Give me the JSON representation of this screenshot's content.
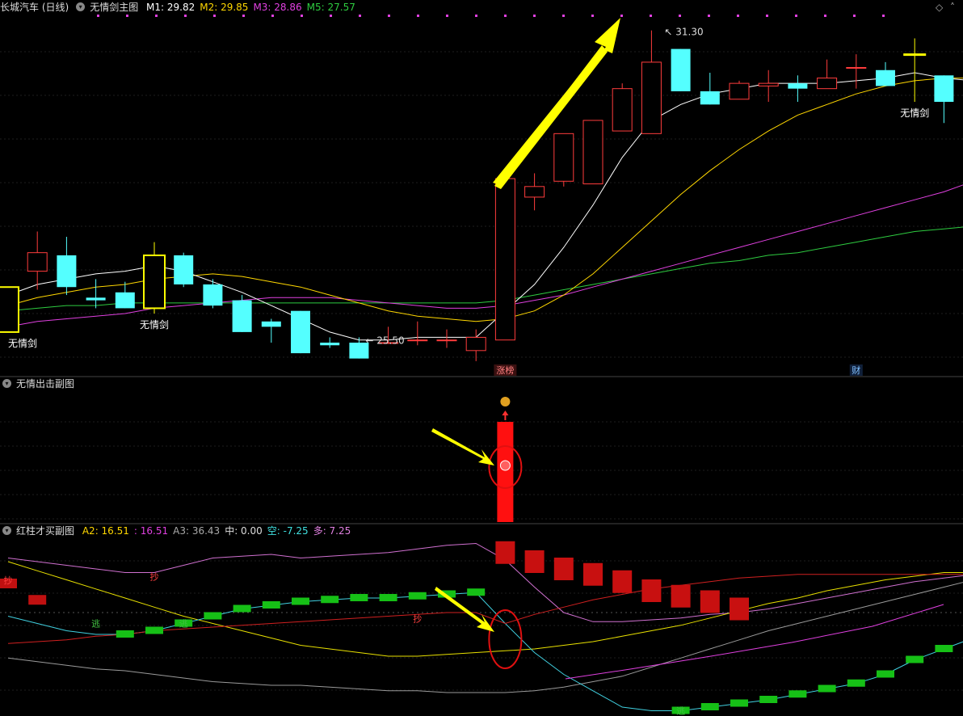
{
  "main_panel": {
    "stock_name": "长城汽车 (日线)",
    "indicator_name": "无情剑主图",
    "legend": [
      {
        "label": "M1:",
        "value": "29.82",
        "color": "#ffffff"
      },
      {
        "label": "M2:",
        "value": "29.85",
        "color": "#ffd700"
      },
      {
        "label": "M3:",
        "value": "28.86",
        "color": "#e040e0"
      },
      {
        "label": "M5:",
        "value": "27.57",
        "color": "#2ecc40"
      }
    ],
    "signal_label": "无情剑",
    "high_label": "31.30",
    "low_label": "25.50",
    "event_zhangbang": "涨榜",
    "event_cai": "财"
  },
  "sub_panel_1": {
    "title": "无情出击副图"
  },
  "sub_panel_2": {
    "title": "红柱才买副图",
    "legend": [
      {
        "label": "A2:",
        "value": "16.51",
        "color": "#ffd700"
      },
      {
        "label": ":",
        "value": "16.51",
        "color": "#e040e0"
      },
      {
        "label": "A3:",
        "value": "36.43",
        "color": "#aaaaaa"
      },
      {
        "label": "中:",
        "value": "0.00",
        "color": "#dddddd"
      },
      {
        "label": "空:",
        "value": "-7.25",
        "color": "#40e0e0"
      },
      {
        "label": "多:",
        "value": "7.25",
        "color": "#e080e0"
      }
    ],
    "marker_chao": "抄",
    "marker_tao": "逃"
  },
  "colors": {
    "up": "#ff3c3c",
    "down": "#54ffff",
    "m1": "#ffffff",
    "m2": "#ffd700",
    "m3": "#e040e0",
    "m5": "#2ecc40",
    "highlight": "#ffff00",
    "arrow": "#ffff00",
    "circle": "#e01010"
  },
  "chart_data": [
    {
      "type": "candlestick",
      "series_names": [
        "M1",
        "M2",
        "M3",
        "M5"
      ],
      "ohlc": [
        [
          26.45,
          26.45,
          25.6,
          25.6
        ],
        [
          26.75,
          27.5,
          26.4,
          27.1
        ],
        [
          27.05,
          27.4,
          26.3,
          26.45
        ],
        [
          26.25,
          26.6,
          26.05,
          26.2
        ],
        [
          26.35,
          26.55,
          26.05,
          26.05
        ],
        [
          26.05,
          27.3,
          25.95,
          27.05
        ],
        [
          27.05,
          27.1,
          26.45,
          26.5
        ],
        [
          26.5,
          26.6,
          26.05,
          26.1
        ],
        [
          26.2,
          26.3,
          25.6,
          25.6
        ],
        [
          25.8,
          25.85,
          25.4,
          25.7
        ],
        [
          26.0,
          26.0,
          25.2,
          25.2
        ],
        [
          25.4,
          25.5,
          25.3,
          25.35
        ],
        [
          25.4,
          25.5,
          25.1,
          25.1
        ],
        [
          25.4,
          25.7,
          25.4,
          25.4
        ],
        [
          25.45,
          25.8,
          25.35,
          25.45
        ],
        [
          25.45,
          25.65,
          25.3,
          25.45
        ],
        [
          25.25,
          25.65,
          25.05,
          25.5
        ],
        [
          25.45,
          28.5,
          25.45,
          28.5
        ],
        [
          28.15,
          28.6,
          27.9,
          28.35
        ],
        [
          28.45,
          29.1,
          28.35,
          29.35
        ],
        [
          28.4,
          29.6,
          28.4,
          29.6
        ],
        [
          29.4,
          30.3,
          29.4,
          30.2
        ],
        [
          29.35,
          31.3,
          29.35,
          30.7
        ],
        [
          30.95,
          30.95,
          30.15,
          30.15
        ],
        [
          30.15,
          30.5,
          29.9,
          29.9
        ],
        [
          30.0,
          30.35,
          30.0,
          30.3
        ],
        [
          30.25,
          30.55,
          29.95,
          30.3
        ],
        [
          30.3,
          30.45,
          29.95,
          30.2
        ],
        [
          30.2,
          30.75,
          30.2,
          30.4
        ],
        [
          30.6,
          30.85,
          30.2,
          30.6
        ],
        [
          30.55,
          30.7,
          30.25,
          30.25
        ],
        [
          30.85,
          31.15,
          29.95,
          30.85
        ],
        [
          30.45,
          30.45,
          29.55,
          29.95
        ],
        [
          30.0,
          30.5,
          29.7,
          30.25
        ],
        [
          30.5,
          30.5,
          30.2,
          30.35
        ]
      ],
      "M1": [
        26.3,
        26.5,
        26.6,
        26.7,
        26.75,
        26.85,
        26.75,
        26.55,
        26.35,
        26.1,
        25.85,
        25.6,
        25.45,
        25.45,
        25.5,
        25.5,
        25.5,
        26.0,
        26.5,
        27.2,
        28.0,
        28.9,
        29.6,
        29.9,
        30.1,
        30.2,
        30.3,
        30.3,
        30.3,
        30.35,
        30.4,
        30.5,
        30.4,
        30.35,
        30.3
      ],
      "M2": [
        26.1,
        26.25,
        26.35,
        26.45,
        26.5,
        26.6,
        26.65,
        26.7,
        26.65,
        26.55,
        26.45,
        26.3,
        26.15,
        26.0,
        25.9,
        25.85,
        25.8,
        25.85,
        26.0,
        26.3,
        26.7,
        27.2,
        27.7,
        28.2,
        28.65,
        29.05,
        29.4,
        29.7,
        29.9,
        30.1,
        30.25,
        30.35,
        30.4,
        30.4,
        30.4
      ],
      "M3": [
        25.7,
        25.8,
        25.85,
        25.9,
        25.95,
        26.05,
        26.1,
        26.15,
        26.2,
        26.25,
        26.25,
        26.25,
        26.2,
        26.15,
        26.1,
        26.05,
        26.05,
        26.1,
        26.2,
        26.3,
        26.45,
        26.6,
        26.75,
        26.9,
        27.05,
        27.2,
        27.35,
        27.5,
        27.65,
        27.8,
        27.95,
        28.1,
        28.25,
        28.45,
        28.65
      ],
      "M5": [
        26.0,
        26.05,
        26.1,
        26.1,
        26.15,
        26.15,
        26.15,
        26.15,
        26.15,
        26.15,
        26.15,
        26.15,
        26.15,
        26.15,
        26.15,
        26.15,
        26.15,
        26.2,
        26.3,
        26.4,
        26.5,
        26.6,
        26.7,
        26.8,
        26.9,
        26.95,
        27.05,
        27.1,
        27.2,
        27.3,
        27.4,
        27.5,
        27.55,
        27.6,
        27.6
      ],
      "signal_bars": [
        0,
        5,
        31
      ],
      "high": 31.3,
      "low": 25.5
    },
    {
      "type": "bar",
      "title": "无情出击副图",
      "signal_bar_index": 17
    },
    {
      "type": "line",
      "title": "红柱才买副图",
      "series_names": [
        "A2",
        "A3",
        "空",
        "多",
        "multi"
      ],
      "A2": [
        28,
        23,
        18,
        13,
        8,
        3,
        -2,
        -6,
        -10,
        -14,
        -18,
        -20,
        -22,
        -24,
        -24,
        -23,
        -22,
        -21,
        -20,
        -18,
        -16,
        -13,
        -10,
        -7,
        -3,
        1,
        5,
        8,
        12,
        15,
        18,
        20,
        22,
        22,
        21
      ],
      "pink": [
        30,
        28,
        26,
        24,
        22,
        22,
        26,
        30,
        31,
        32,
        30,
        31,
        32,
        33,
        35,
        37,
        38,
        29,
        14,
        0,
        -5,
        -5,
        -4,
        -3,
        -1,
        0,
        2,
        5,
        8,
        11,
        14,
        17,
        19,
        21,
        22
      ],
      "A3": [
        -25,
        -27,
        -29,
        -31,
        -32,
        -34,
        -36,
        -38,
        -39,
        -40,
        -40,
        -41,
        -42,
        -43,
        -43,
        -44,
        -44,
        -44,
        -43,
        -41,
        -38,
        -35,
        -30,
        -25,
        -20,
        -15,
        -10,
        -6,
        -2,
        2,
        6,
        10,
        14,
        18,
        22
      ],
      "cyan": [
        -2,
        -6,
        -10,
        -12,
        -12,
        -10,
        -6,
        -2,
        2,
        4,
        6,
        7,
        8,
        8,
        9,
        10,
        11,
        -6,
        -22,
        -34,
        -43,
        -52,
        -54,
        -54,
        -52,
        -50,
        -48,
        -45,
        -42,
        -39,
        -34,
        -26,
        -20,
        -14,
        -11
      ],
      "red": [
        -17,
        -16,
        -15,
        -13,
        -12,
        -10,
        -9,
        -8,
        -7,
        -6,
        -5,
        -4,
        -3,
        -2,
        -1,
        0,
        0,
        -6,
        -1,
        3,
        7,
        10,
        13,
        15,
        17,
        19,
        20,
        21,
        21,
        21,
        21,
        21,
        21,
        21,
        21
      ],
      "bar_values": [
        16,
        7,
        null,
        null,
        null,
        null,
        null,
        null,
        null,
        null,
        null,
        null,
        null,
        null,
        null,
        null,
        null,
        33,
        28,
        24,
        21,
        17,
        12,
        9,
        6,
        2,
        null,
        null,
        null,
        null,
        null,
        null,
        null,
        null,
        null,
        null
      ],
      "zhong": 0.0,
      "kong": -7.25,
      "duo": 7.25
    }
  ]
}
